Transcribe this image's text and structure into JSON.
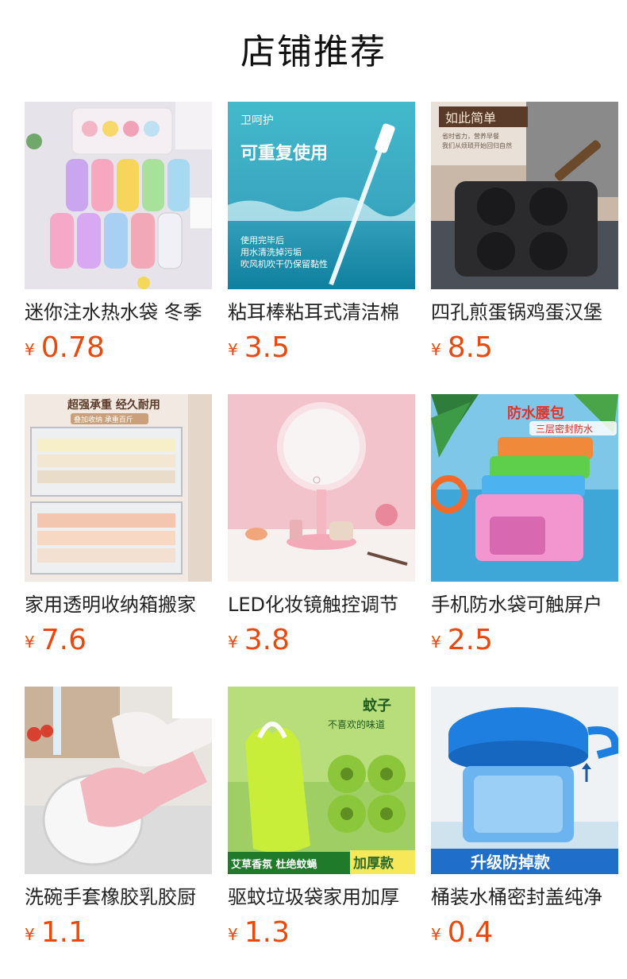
{
  "page_title": "店铺推荐",
  "currency_symbol": "¥",
  "products": [
    {
      "name": "迷你注水热水袋 冬季",
      "price": "0.78"
    },
    {
      "name": "粘耳棒粘耳式清洁棉",
      "price": "3.5",
      "image_text": [
        "卫呵护",
        "可重复使用",
        "使用完毕后",
        "用水清洗掉污垢",
        "吹风机吹干仍保留黏性"
      ]
    },
    {
      "name": "四孔煎蛋锅鸡蛋汉堡",
      "price": "8.5",
      "image_text": [
        "如此简单",
        "省时省力，营养早餐",
        "我们从烦琐开始回归自然"
      ]
    },
    {
      "name": "家用透明收纳箱搬家",
      "price": "7.6",
      "image_text": [
        "超强承重 经久耐用",
        "叠加收纳 承重百斤"
      ]
    },
    {
      "name": "LED化妆镜触控调节",
      "price": "3.8"
    },
    {
      "name": "手机防水袋可触屏户",
      "price": "2.5",
      "image_text": [
        "防水腰包",
        "三层密封防水"
      ]
    },
    {
      "name": "洗碗手套橡胶乳胶厨",
      "price": "1.1"
    },
    {
      "name": "驱蚊垃圾袋家用加厚",
      "price": "1.3",
      "image_text": [
        "蚊子",
        "不喜欢的味道",
        "艾草香氛 杜绝蚊蝇",
        "加厚款"
      ]
    },
    {
      "name": "桶装水桶密封盖纯净",
      "price": "0.4",
      "image_text": [
        "升级防掉款"
      ]
    }
  ]
}
